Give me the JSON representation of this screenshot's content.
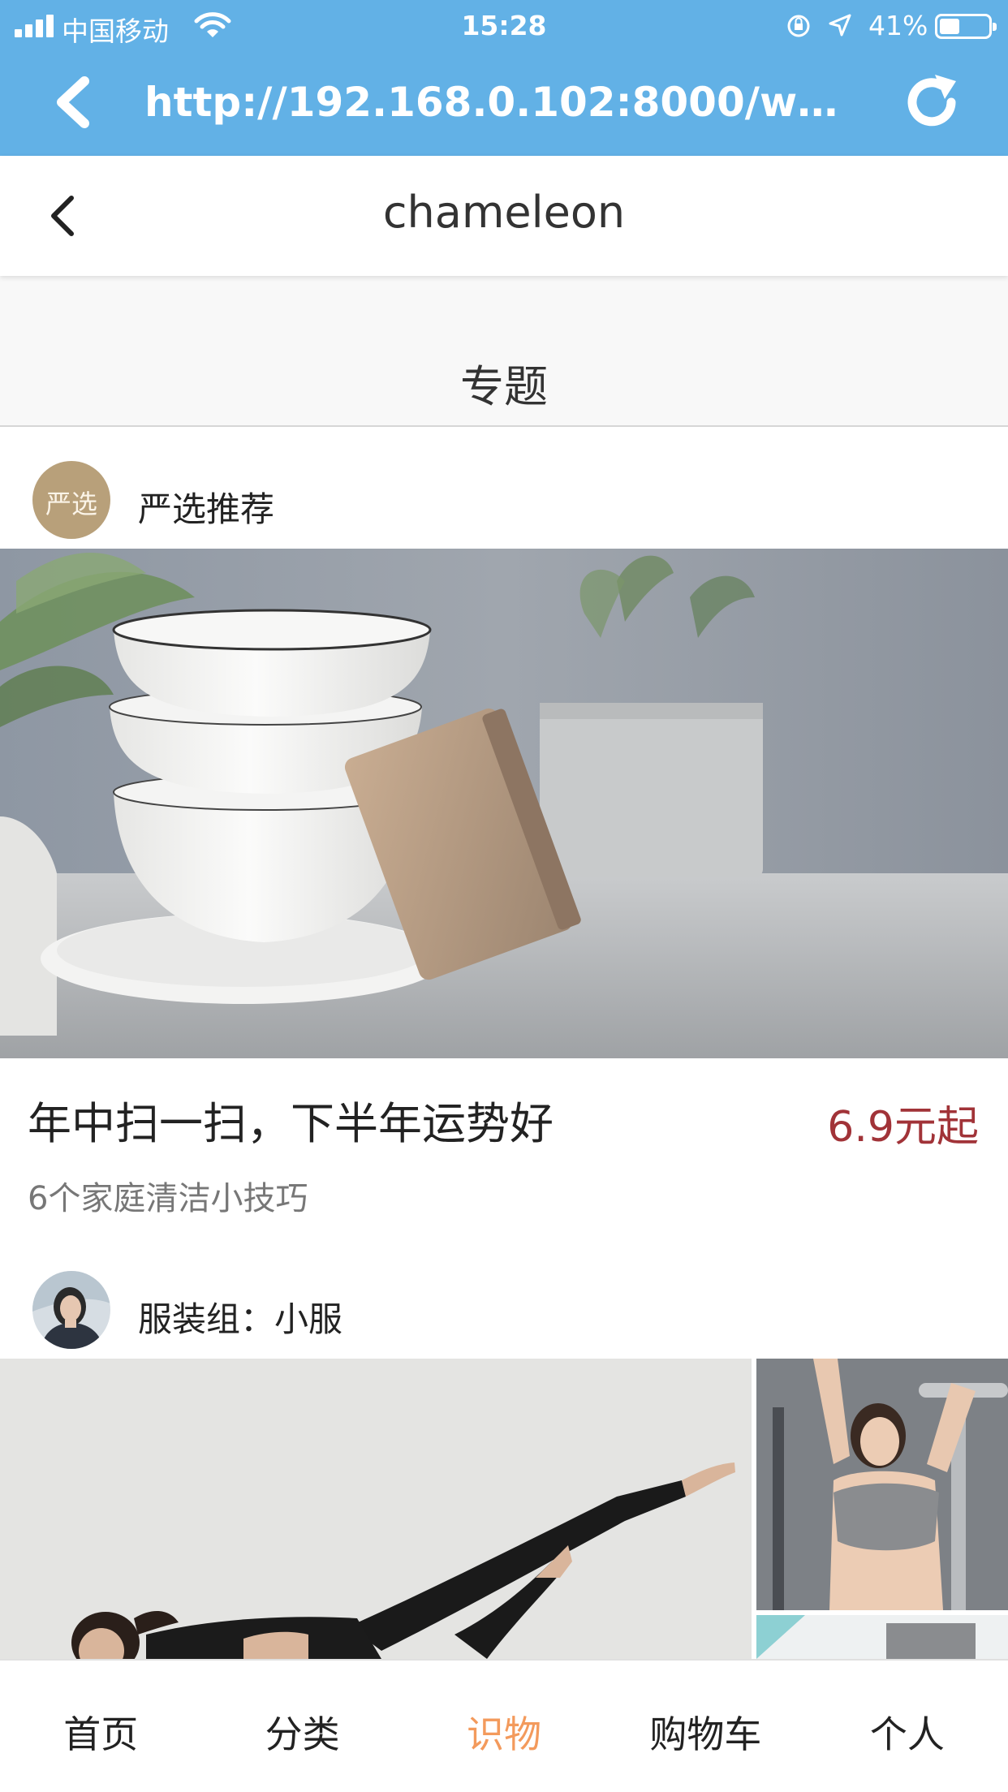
{
  "status_bar": {
    "carrier": "中国移动",
    "time": "15:28",
    "battery_percent": "41%",
    "battery_level": 0.41
  },
  "browser": {
    "url": "http://192.168.0.102:8000/weex/c..."
  },
  "nav": {
    "title": "chameleon"
  },
  "section": {
    "title": "专题"
  },
  "cards": [
    {
      "author_name": "严选推荐",
      "avatar_text": "严选",
      "title": "年中扫一扫，下半年运势好",
      "price": "6.9元起",
      "subtitle": "6个家庭清洁小技巧"
    },
    {
      "author_name": "服装组：小服"
    }
  ],
  "tabbar": {
    "items": [
      {
        "label": "首页",
        "active": false
      },
      {
        "label": "分类",
        "active": false
      },
      {
        "label": "识物",
        "active": true
      },
      {
        "label": "购物车",
        "active": false
      },
      {
        "label": "个人",
        "active": false
      }
    ],
    "active_color": "#f39a5c"
  },
  "colors": {
    "browser_bar": "#62b1e6",
    "price": "#a13338"
  }
}
